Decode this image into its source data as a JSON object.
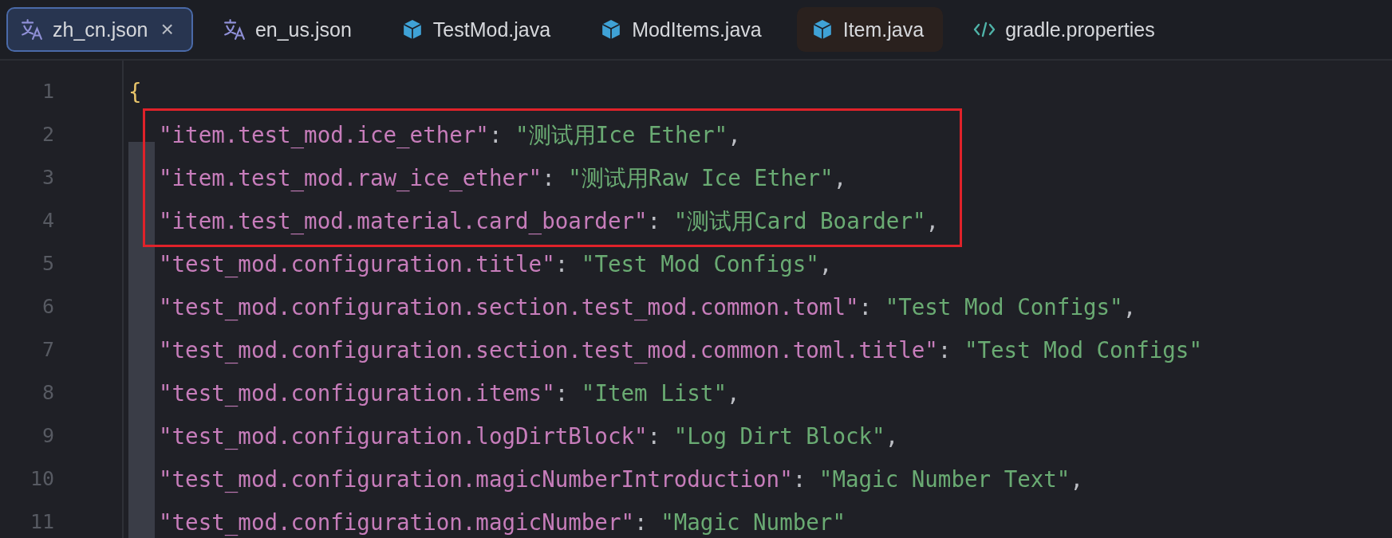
{
  "tabs": [
    {
      "label": "zh_cn.json",
      "kind": "translation",
      "selected": true,
      "highlighted": false,
      "close": "×"
    },
    {
      "label": "en_us.json",
      "kind": "translation",
      "selected": false,
      "highlighted": false
    },
    {
      "label": "TestMod.java",
      "kind": "java_class",
      "selected": false,
      "highlighted": false
    },
    {
      "label": "ModItems.java",
      "kind": "java_class",
      "selected": false,
      "highlighted": false
    },
    {
      "label": "Item.java",
      "kind": "java_class",
      "selected": false,
      "highlighted": true
    },
    {
      "label": "gradle.properties",
      "kind": "code",
      "selected": false,
      "highlighted": false
    }
  ],
  "editor": {
    "lines": [
      {
        "number": "1",
        "boxed": false,
        "tokens": [
          {
            "kind": "brace",
            "text": "{"
          }
        ]
      },
      {
        "number": "2",
        "boxed": true,
        "tokens": [
          {
            "kind": "key",
            "text": "\"item.test_mod.ice_ether\""
          },
          {
            "kind": "punct",
            "text": ": "
          },
          {
            "kind": "string",
            "text": "\"测试用Ice Ether\""
          },
          {
            "kind": "punct",
            "text": ","
          }
        ]
      },
      {
        "number": "3",
        "boxed": true,
        "tokens": [
          {
            "kind": "key",
            "text": "\"item.test_mod.raw_ice_ether\""
          },
          {
            "kind": "punct",
            "text": ": "
          },
          {
            "kind": "string",
            "text": "\"测试用Raw Ice Ether\""
          },
          {
            "kind": "punct",
            "text": ","
          }
        ]
      },
      {
        "number": "4",
        "boxed": true,
        "tokens": [
          {
            "kind": "key",
            "text": "\"item.test_mod.material.card_boarder\""
          },
          {
            "kind": "punct",
            "text": ": "
          },
          {
            "kind": "string",
            "text": "\"测试用Card Boarder\""
          },
          {
            "kind": "punct",
            "text": ","
          }
        ]
      },
      {
        "number": "5",
        "boxed": false,
        "tokens": [
          {
            "kind": "key",
            "text": "\"test_mod.configuration.title\""
          },
          {
            "kind": "punct",
            "text": ": "
          },
          {
            "kind": "string",
            "text": "\"Test Mod Configs\""
          },
          {
            "kind": "punct",
            "text": ","
          }
        ]
      },
      {
        "number": "6",
        "boxed": false,
        "tokens": [
          {
            "kind": "key",
            "text": "\"test_mod.configuration.section.test_mod.common.toml\""
          },
          {
            "kind": "punct",
            "text": ": "
          },
          {
            "kind": "string",
            "text": "\"Test Mod Configs\""
          },
          {
            "kind": "punct",
            "text": ","
          }
        ]
      },
      {
        "number": "7",
        "boxed": false,
        "tokens": [
          {
            "kind": "key",
            "text": "\"test_mod.configuration.section.test_mod.common.toml.title\""
          },
          {
            "kind": "punct",
            "text": ": "
          },
          {
            "kind": "string",
            "text": "\"Test Mod Configs\""
          }
        ]
      },
      {
        "number": "8",
        "boxed": false,
        "tokens": [
          {
            "kind": "key",
            "text": "\"test_mod.configuration.items\""
          },
          {
            "kind": "punct",
            "text": ": "
          },
          {
            "kind": "string",
            "text": "\"Item List\""
          },
          {
            "kind": "punct",
            "text": ","
          }
        ]
      },
      {
        "number": "9",
        "boxed": false,
        "tokens": [
          {
            "kind": "key",
            "text": "\"test_mod.configuration.logDirtBlock\""
          },
          {
            "kind": "punct",
            "text": ": "
          },
          {
            "kind": "string",
            "text": "\"Log Dirt Block\""
          },
          {
            "kind": "punct",
            "text": ","
          }
        ]
      },
      {
        "number": "10",
        "boxed": false,
        "tokens": [
          {
            "kind": "key",
            "text": "\"test_mod.configuration.magicNumberIntroduction\""
          },
          {
            "kind": "punct",
            "text": ": "
          },
          {
            "kind": "string",
            "text": "\"Magic Number Text\""
          },
          {
            "kind": "punct",
            "text": ","
          }
        ]
      },
      {
        "number": "11",
        "boxed": false,
        "tokens": [
          {
            "kind": "key",
            "text": "\"test_mod.configuration.magicNumber\""
          },
          {
            "kind": "punct",
            "text": ": "
          },
          {
            "kind": "string",
            "text": "\"Magic Number\""
          }
        ]
      }
    ]
  }
}
